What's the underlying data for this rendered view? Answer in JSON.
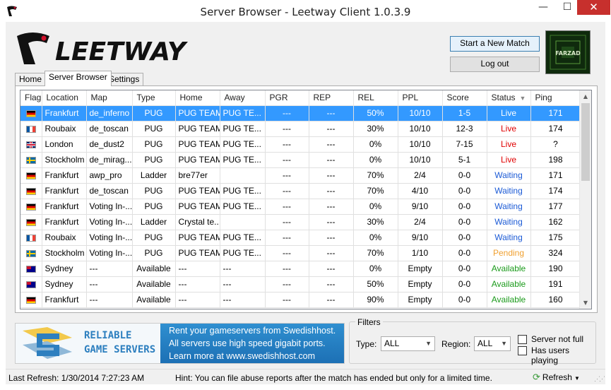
{
  "window": {
    "title": "Server Browser - Leetway Client 1.0.3.9",
    "controls": {
      "minimize": "—",
      "maximize": "☐",
      "close": "✕"
    }
  },
  "header": {
    "logo_text": "LEETWAY",
    "start_match_label": "Start a New Match",
    "logout_label": "Log out",
    "avatar_text": "FARZAD"
  },
  "tabs": [
    {
      "label": "Home"
    },
    {
      "label": "Server Browser"
    },
    {
      "label": "Settings"
    }
  ],
  "columns": [
    "Flag",
    "Location",
    "Map",
    "Type",
    "Home",
    "Away",
    "PGR",
    "REP",
    "REL",
    "PPL",
    "Score",
    "Status",
    "Ping"
  ],
  "colors": {
    "live": "#e00000",
    "waiting": "#1c5bd6",
    "pending": "#f0a030",
    "available": "#1a9a1a",
    "selected_row": "#3399ff"
  },
  "rows": [
    {
      "flag": "de",
      "location": "Frankfurt",
      "map": "de_inferno",
      "type": "PUG",
      "home": "PUG TEAM",
      "away": "PUG TE...",
      "pgr": "---",
      "rep": "---",
      "rel": "50%",
      "ppl": "10/10",
      "score": "1-5",
      "status": "Live",
      "status_kind": "live",
      "ping": "171",
      "selected": true
    },
    {
      "flag": "fr",
      "location": "Roubaix",
      "map": "de_toscan",
      "type": "PUG",
      "home": "PUG TEAM",
      "away": "PUG TE...",
      "pgr": "---",
      "rep": "---",
      "rel": "30%",
      "ppl": "10/10",
      "score": "12-3",
      "status": "Live",
      "status_kind": "live",
      "ping": "174"
    },
    {
      "flag": "gb",
      "location": "London",
      "map": "de_dust2",
      "type": "PUG",
      "home": "PUG TEAM",
      "away": "PUG TE...",
      "pgr": "---",
      "rep": "---",
      "rel": "0%",
      "ppl": "10/10",
      "score": "7-15",
      "status": "Live",
      "status_kind": "live",
      "ping": "?"
    },
    {
      "flag": "se",
      "location": "Stockholm",
      "map": "de_mirag...",
      "type": "PUG",
      "home": "PUG TEAM",
      "away": "PUG TE...",
      "pgr": "---",
      "rep": "---",
      "rel": "0%",
      "ppl": "10/10",
      "score": "5-1",
      "status": "Live",
      "status_kind": "live",
      "ping": "198"
    },
    {
      "flag": "de",
      "location": "Frankfurt",
      "map": "awp_pro",
      "type": "Ladder",
      "home": "bre77er",
      "away": "",
      "pgr": "---",
      "rep": "---",
      "rel": "70%",
      "ppl": "2/4",
      "score": "0-0",
      "status": "Waiting",
      "status_kind": "waiting",
      "ping": "171"
    },
    {
      "flag": "de",
      "location": "Frankfurt",
      "map": "de_toscan",
      "type": "PUG",
      "home": "PUG TEAM",
      "away": "PUG TE...",
      "pgr": "---",
      "rep": "---",
      "rel": "70%",
      "ppl": "4/10",
      "score": "0-0",
      "status": "Waiting",
      "status_kind": "waiting",
      "ping": "174"
    },
    {
      "flag": "de",
      "location": "Frankfurt",
      "map": "Voting In-...",
      "type": "PUG",
      "home": "PUG TEAM",
      "away": "PUG TE...",
      "pgr": "---",
      "rep": "---",
      "rel": "0%",
      "ppl": "9/10",
      "score": "0-0",
      "status": "Waiting",
      "status_kind": "waiting",
      "ping": "177"
    },
    {
      "flag": "de",
      "location": "Frankfurt",
      "map": "Voting In-...",
      "type": "Ladder",
      "home": "Crystal te...",
      "away": "",
      "pgr": "---",
      "rep": "---",
      "rel": "30%",
      "ppl": "2/4",
      "score": "0-0",
      "status": "Waiting",
      "status_kind": "waiting",
      "ping": "162"
    },
    {
      "flag": "fr",
      "location": "Roubaix",
      "map": "Voting In-...",
      "type": "PUG",
      "home": "PUG TEAM",
      "away": "PUG TE...",
      "pgr": "---",
      "rep": "---",
      "rel": "0%",
      "ppl": "9/10",
      "score": "0-0",
      "status": "Waiting",
      "status_kind": "waiting",
      "ping": "175"
    },
    {
      "flag": "se",
      "location": "Stockholm",
      "map": "Voting In-...",
      "type": "PUG",
      "home": "PUG TEAM",
      "away": "PUG TE...",
      "pgr": "---",
      "rep": "---",
      "rel": "70%",
      "ppl": "1/10",
      "score": "0-0",
      "status": "Pending",
      "status_kind": "pending",
      "ping": "324"
    },
    {
      "flag": "au",
      "location": "Sydney",
      "map": "---",
      "type": "Available",
      "home": "---",
      "away": "---",
      "pgr": "---",
      "rep": "---",
      "rel": "0%",
      "ppl": "Empty",
      "score": "0-0",
      "status": "Available",
      "status_kind": "available",
      "ping": "190"
    },
    {
      "flag": "au",
      "location": "Sydney",
      "map": "---",
      "type": "Available",
      "home": "---",
      "away": "---",
      "pgr": "---",
      "rep": "---",
      "rel": "50%",
      "ppl": "Empty",
      "score": "0-0",
      "status": "Available",
      "status_kind": "available",
      "ping": "191"
    },
    {
      "flag": "de",
      "location": "Frankfurt",
      "map": "---",
      "type": "Available",
      "home": "---",
      "away": "---",
      "pgr": "---",
      "rep": "---",
      "rel": "90%",
      "ppl": "Empty",
      "score": "0-0",
      "status": "Available",
      "status_kind": "available",
      "ping": "160"
    }
  ],
  "banner": {
    "logo_line1": "RELIABLE",
    "logo_line2": "GAME SERVERS",
    "line1": "Rent your gameservers from Swedishhost.",
    "line2": "All servers use high speed gigabit ports.",
    "line3": "Learn more at www.swedishhost.com"
  },
  "filters": {
    "legend": "Filters",
    "type_label": "Type:",
    "type_value": "ALL",
    "region_label": "Region:",
    "region_value": "ALL",
    "not_full_label": "Server not full",
    "has_players_label": "Has users playing"
  },
  "status": {
    "last_refresh": "Last Refresh: 1/30/2014 7:27:23 AM",
    "hint": "Hint: You can file abuse reports after the match has ended but only for a limited time.",
    "refresh_label": "Refresh"
  }
}
